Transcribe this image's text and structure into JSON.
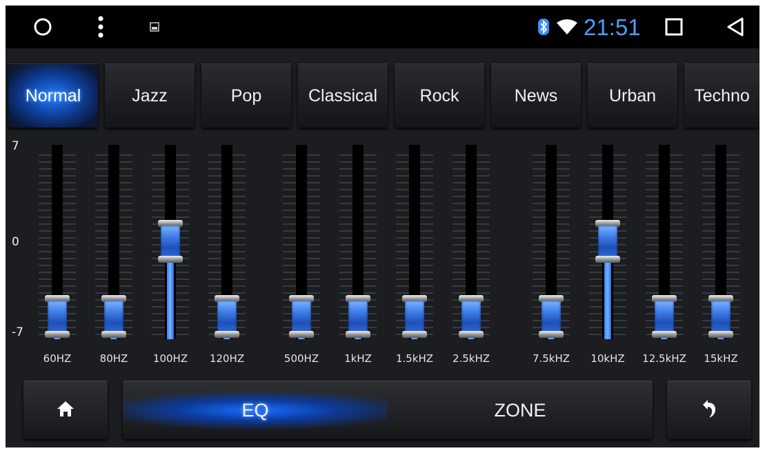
{
  "status_bar": {
    "time": "21:51",
    "icons": [
      "circle-home-icon",
      "more-vert-icon",
      "image-icon",
      "bluetooth-icon",
      "wifi-icon",
      "recents-square-icon",
      "back-triangle-icon"
    ]
  },
  "colors": {
    "accent_blue": "#1f7bff",
    "clock_blue": "#4aa0ff",
    "background": "#1c1d20",
    "status_bar": "#000000"
  },
  "presets": [
    {
      "label": "Normal",
      "active": true
    },
    {
      "label": "Jazz",
      "active": false
    },
    {
      "label": "Pop",
      "active": false
    },
    {
      "label": "Classical",
      "active": false
    },
    {
      "label": "Rock",
      "active": false
    },
    {
      "label": "News",
      "active": false
    },
    {
      "label": "Urban",
      "active": false
    },
    {
      "label": "Techno",
      "active": false
    }
  ],
  "eq": {
    "scale_max": "7",
    "scale_mid": "0",
    "scale_min": "-7",
    "bands": [
      {
        "label": "60HZ",
        "value": -7
      },
      {
        "label": "80HZ",
        "value": -7
      },
      {
        "label": "100HZ",
        "value": 0
      },
      {
        "label": "120HZ",
        "value": -7
      },
      {
        "label": "500HZ",
        "value": -7
      },
      {
        "label": "1kHZ",
        "value": -7
      },
      {
        "label": "1.5kHZ",
        "value": -7
      },
      {
        "label": "2.5kHZ",
        "value": -7
      },
      {
        "label": "7.5kHZ",
        "value": -7
      },
      {
        "label": "10kHZ",
        "value": 0
      },
      {
        "label": "12.5kHZ",
        "value": -7
      },
      {
        "label": "15kHZ",
        "value": -7
      }
    ]
  },
  "bottom_bar": {
    "home_icon": "home-icon",
    "back_icon": "undo-arrow-icon",
    "modes": [
      {
        "label": "EQ",
        "active": true
      },
      {
        "label": "ZONE",
        "active": false
      }
    ]
  }
}
